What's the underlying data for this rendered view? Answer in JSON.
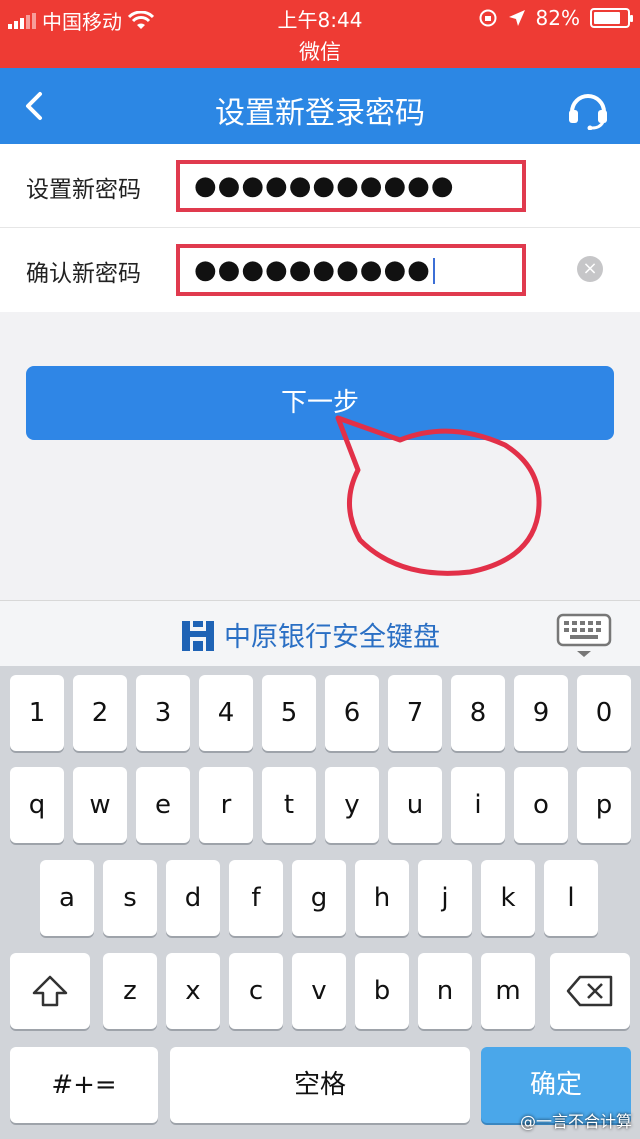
{
  "status_bar": {
    "carrier": "中国移动",
    "time": "上午8:44",
    "app_name": "微信",
    "battery": "82%",
    "battery_level": 0.82
  },
  "nav": {
    "title": "设置新登录密码"
  },
  "form": {
    "new_password_label": "设置新密码",
    "new_password_value": "●●●●●●●●●●●",
    "confirm_password_label": "确认新密码",
    "confirm_password_value": "●●●●●●●●●●",
    "clear_symbol": "×"
  },
  "next_button": "下一步",
  "keyboard": {
    "title": "中原银行安全键盘",
    "row_numbers": [
      "1",
      "2",
      "3",
      "4",
      "5",
      "6",
      "7",
      "8",
      "9",
      "0"
    ],
    "row_top": [
      "q",
      "w",
      "e",
      "r",
      "t",
      "y",
      "u",
      "i",
      "o",
      "p"
    ],
    "row_mid": [
      "a",
      "s",
      "d",
      "f",
      "g",
      "h",
      "j",
      "k",
      "l"
    ],
    "row_bottom": [
      "z",
      "x",
      "c",
      "v",
      "b",
      "n",
      "m"
    ],
    "symbols_key": "#+=",
    "space_key": "空格",
    "confirm_key": "确定"
  },
  "watermark": "@一言不合计算",
  "colors": {
    "status_bar": "#ee3b34",
    "nav_bar": "#2c87e4",
    "highlight_border": "#e03a4e",
    "primary_button": "#2f86e6",
    "confirm_key": "#4aa7ea"
  }
}
